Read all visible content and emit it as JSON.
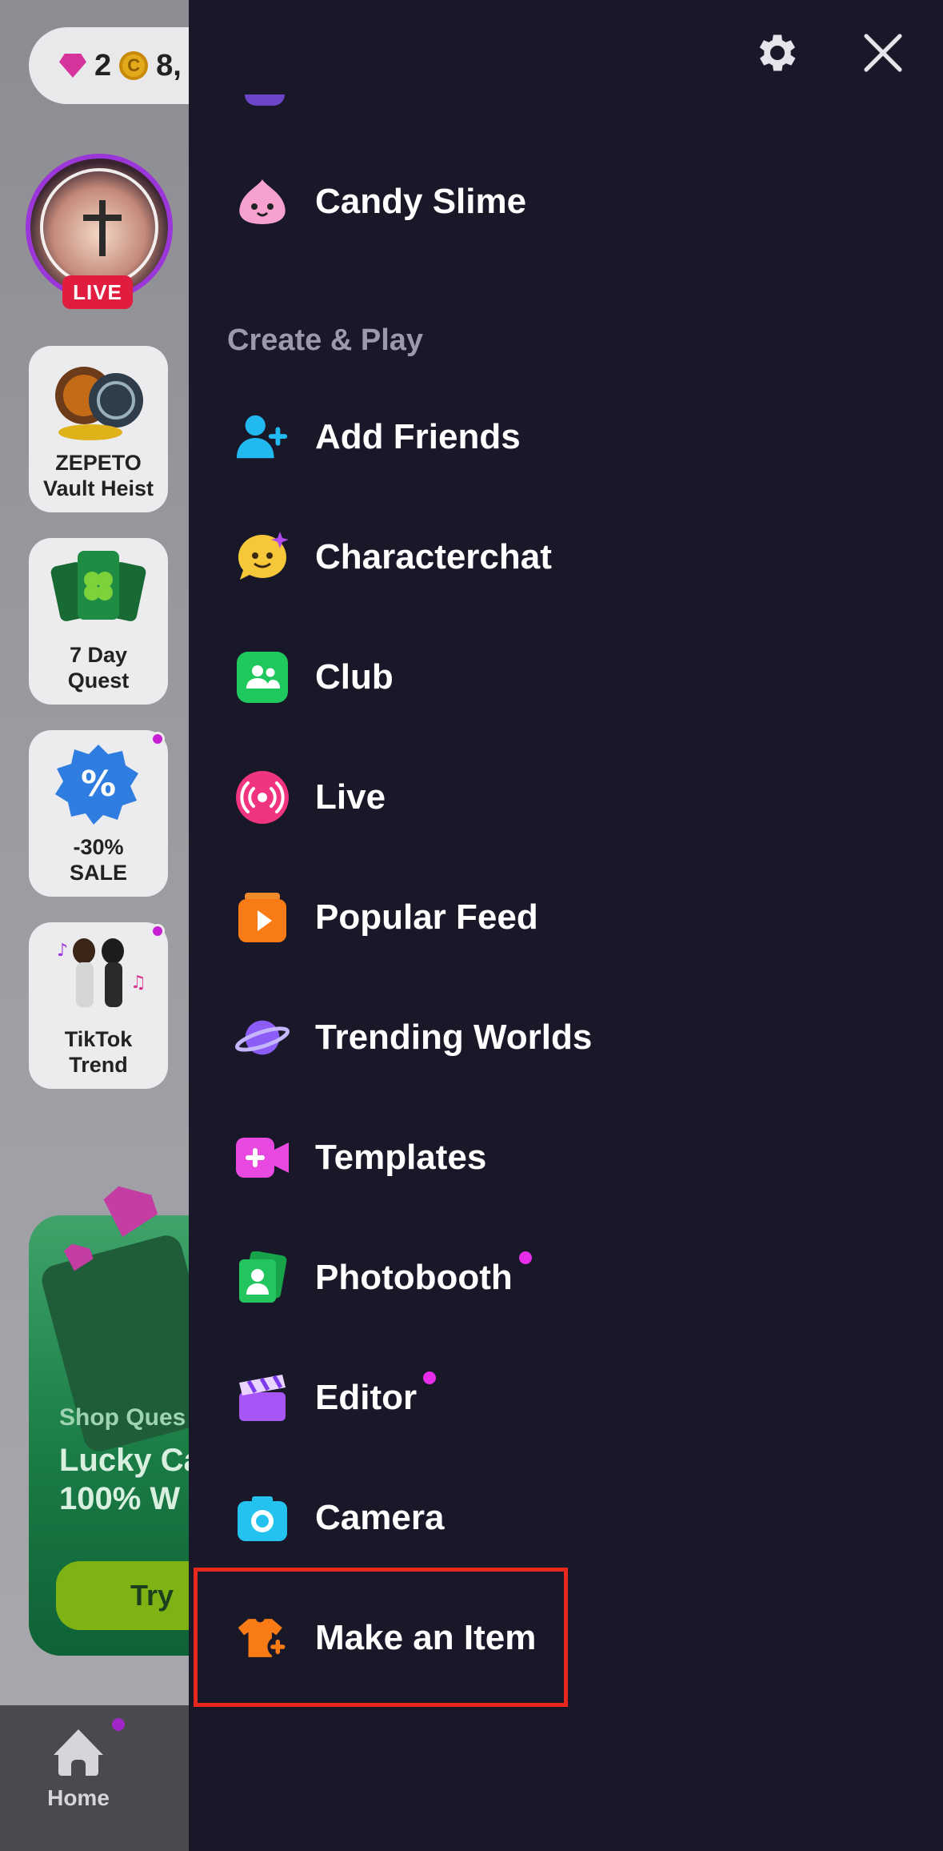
{
  "background": {
    "currency": {
      "gems": "2",
      "coins": "8,"
    },
    "live_badge": "LIVE",
    "tiles": [
      {
        "label": "ZEPETO\nVault Heist",
        "line1": "ZEPETO",
        "line2": "Vault Heist"
      },
      {
        "label": "7 Day Quest",
        "line1": "7 Day",
        "line2": "Quest"
      },
      {
        "label": "-30% SALE",
        "line1": "-30%",
        "line2": "SALE"
      },
      {
        "label": "TikTok Trend",
        "line1": "TikTok",
        "line2": "Trend"
      }
    ],
    "banner": {
      "small": "Shop Ques",
      "big_line1": "Lucky Ca",
      "big_line2": "100% W",
      "button": "Try"
    },
    "tabbar": {
      "home": "Home"
    }
  },
  "drawer": {
    "top_item": "Candy Slime",
    "section_title": "Create & Play",
    "items": [
      {
        "label": "Add Friends",
        "icon": "add-friend-icon",
        "new": false
      },
      {
        "label": "Characterchat",
        "icon": "characterchat-icon",
        "new": false
      },
      {
        "label": "Club",
        "icon": "club-icon",
        "new": false
      },
      {
        "label": "Live",
        "icon": "live-broadcast-icon",
        "new": false
      },
      {
        "label": "Popular Feed",
        "icon": "popular-feed-icon",
        "new": false
      },
      {
        "label": "Trending Worlds",
        "icon": "planet-icon",
        "new": false
      },
      {
        "label": "Templates",
        "icon": "video-plus-icon",
        "new": false
      },
      {
        "label": "Photobooth",
        "icon": "photobooth-icon",
        "new": true
      },
      {
        "label": "Editor",
        "icon": "clapperboard-icon",
        "new": true
      },
      {
        "label": "Camera",
        "icon": "camera-icon",
        "new": false
      },
      {
        "label": "Make an Item",
        "icon": "shirt-plus-icon",
        "new": false
      }
    ]
  },
  "colors": {
    "drawer_bg": "#181829",
    "highlight": "#e8281c",
    "new_dot": "#e62ee8"
  }
}
